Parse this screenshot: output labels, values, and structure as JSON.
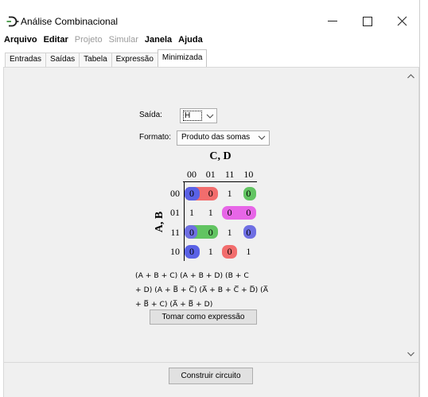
{
  "window": {
    "title": "Análise Combinacional",
    "app_icon": "logisim-app-icon",
    "controls": [
      "minimize-icon",
      "maximize-icon",
      "close-icon"
    ]
  },
  "menu": [
    {
      "label": "Arquivo",
      "enabled": true
    },
    {
      "label": "Editar",
      "enabled": true
    },
    {
      "label": "Projeto",
      "enabled": false
    },
    {
      "label": "Simular",
      "enabled": false
    },
    {
      "label": "Janela",
      "enabled": true
    },
    {
      "label": "Ajuda",
      "enabled": true
    }
  ],
  "tabs": [
    {
      "label": "Entradas",
      "selected": false
    },
    {
      "label": "Saídas",
      "selected": false
    },
    {
      "label": "Tabela",
      "selected": false
    },
    {
      "label": "Expressão",
      "selected": false
    },
    {
      "label": "Minimizada",
      "selected": true
    }
  ],
  "minimized": {
    "output_label": "Saída:",
    "output_value": "H",
    "format_label": "Formato:",
    "format_value": "Produto das somas",
    "kmap": {
      "col_vars": "C, D",
      "row_vars": "A, B",
      "col_headers": [
        "00",
        "01",
        "11",
        "10"
      ],
      "row_headers": [
        "00",
        "01",
        "11",
        "10"
      ],
      "cells": [
        [
          "0",
          "0",
          "1",
          "0"
        ],
        [
          "1",
          "1",
          "0",
          "0"
        ],
        [
          "0",
          "0",
          "1",
          "0"
        ],
        [
          "0",
          "1",
          "0",
          "1"
        ]
      ],
      "groups": [
        {
          "color": "#62c462",
          "cells": [
            [
              0,
              0
            ],
            [
              0,
              3
            ]
          ]
        },
        {
          "color": "#f26d6d",
          "cells": [
            [
              0,
              0
            ],
            [
              0,
              1
            ]
          ]
        },
        {
          "color": "#62c462",
          "cells": [
            [
              2,
              0
            ],
            [
              2,
              1
            ]
          ]
        },
        {
          "color": "#e766e7",
          "cells": [
            [
              1,
              2
            ],
            [
              1,
              3
            ]
          ]
        },
        {
          "color": "#f26d6d",
          "cells": [
            [
              3,
              2
            ]
          ]
        },
        {
          "color": "#5a62e6",
          "cells": [
            [
              0,
              0
            ],
            [
              3,
              0
            ]
          ]
        },
        {
          "color": "#6f6fe3",
          "cells": [
            [
              2,
              0
            ],
            [
              2,
              3
            ]
          ]
        }
      ]
    },
    "expression_lines": [
      "(A + B + C) (A + B + D) (B + C",
      "+ D) (A + B̅ + C̅) (A̅ + B + C̅ + D̅) (A̅",
      "+ B̅ + C) (A̅ + B̅ + D)"
    ],
    "set_expression_button": "Tomar como expressão"
  },
  "build_circuit_button": "Construir circuito",
  "scrollbar_icons": [
    "chevron-up-icon",
    "chevron-down-icon"
  ],
  "colors": {
    "panel_background": "#f0f0f0",
    "button_background": "#e1e1e1"
  }
}
